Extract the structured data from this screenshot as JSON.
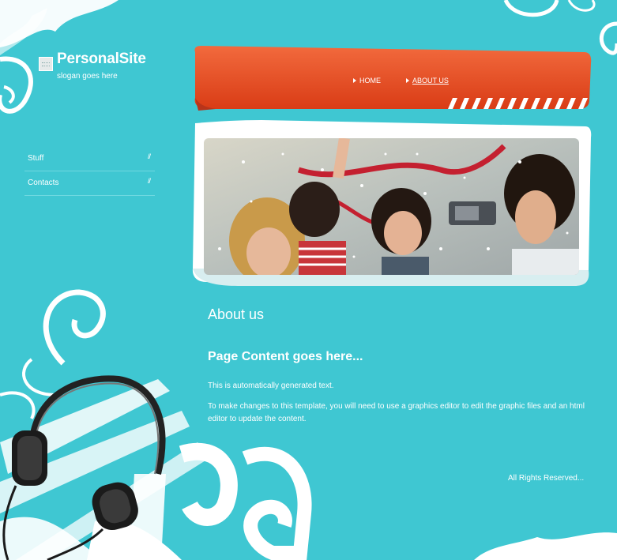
{
  "brand": {
    "title": "PersonalSite",
    "slogan": "slogan goes here"
  },
  "sidebar": {
    "items": [
      {
        "label": "Stuff",
        "mark": "//"
      },
      {
        "label": "Contacts",
        "mark": "//"
      }
    ]
  },
  "top_nav": {
    "items": [
      {
        "label": "HOME",
        "active": false
      },
      {
        "label": "ABOUT US",
        "active": true
      }
    ]
  },
  "main": {
    "heading": "About us",
    "subheading": "Page Content goes here...",
    "paragraphs": [
      "This is automatically generated text.",
      "To make changes to this template, you will need to use a graphics editor to edit the graphic files and an html editor to update the content."
    ]
  },
  "footer": {
    "text": "All Rights Reserved..."
  },
  "colors": {
    "background": "#3fc7d2",
    "banner": "#ee4a22",
    "text": "#ffffff"
  }
}
